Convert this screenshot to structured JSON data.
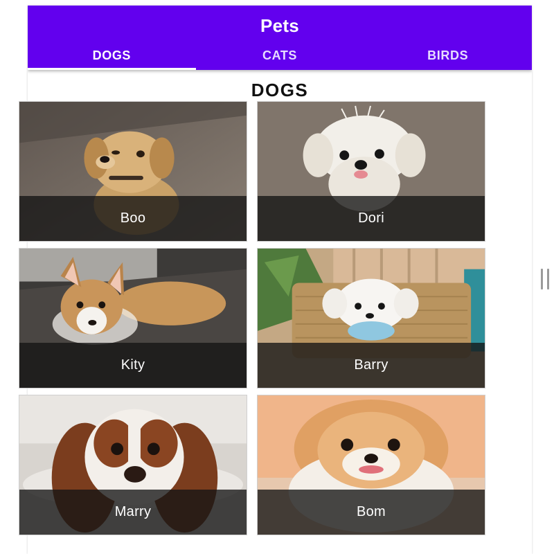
{
  "app": {
    "title": "Pets"
  },
  "tabs": [
    {
      "label": "DOGS",
      "active": true
    },
    {
      "label": "CATS",
      "active": false
    },
    {
      "label": "BIRDS",
      "active": false
    }
  ],
  "section": {
    "title": "DOGS"
  },
  "pets": [
    {
      "name": "Boo"
    },
    {
      "name": "Dori"
    },
    {
      "name": "Kity"
    },
    {
      "name": "Barry"
    },
    {
      "name": "Marry"
    },
    {
      "name": "Bom"
    }
  ],
  "colors": {
    "primary": "#6200ee",
    "caption_overlay": "#141414"
  },
  "icons": {
    "resize_handle": "drag-handle-icon"
  }
}
